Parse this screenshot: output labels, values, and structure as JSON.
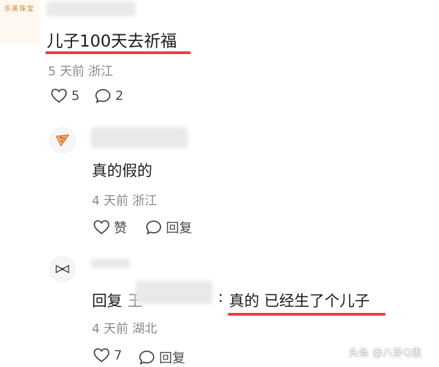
{
  "top_logo_text": "乐美珠宝",
  "post": {
    "text": "儿子100天去祈福",
    "meta": "5 天前  浙江",
    "likes": "5",
    "comments": "2"
  },
  "reply1": {
    "avatar_icon": "pizza-icon",
    "text": "真的假的",
    "meta": "4 天前  浙江",
    "like_label": "赞",
    "reply_label": "回复"
  },
  "reply2": {
    "avatar_icon": "bow-icon",
    "prefix": "回复",
    "name_initial": "王",
    "separator": ":",
    "text": "真的  已经生了个儿子",
    "meta": "4 天前  湖北",
    "likes": "7",
    "reply_label": "回复"
  },
  "watermark": "头条 @八卦Q患",
  "colors": {
    "underline": "#ec3b4b",
    "meta": "#8a8a8a"
  }
}
